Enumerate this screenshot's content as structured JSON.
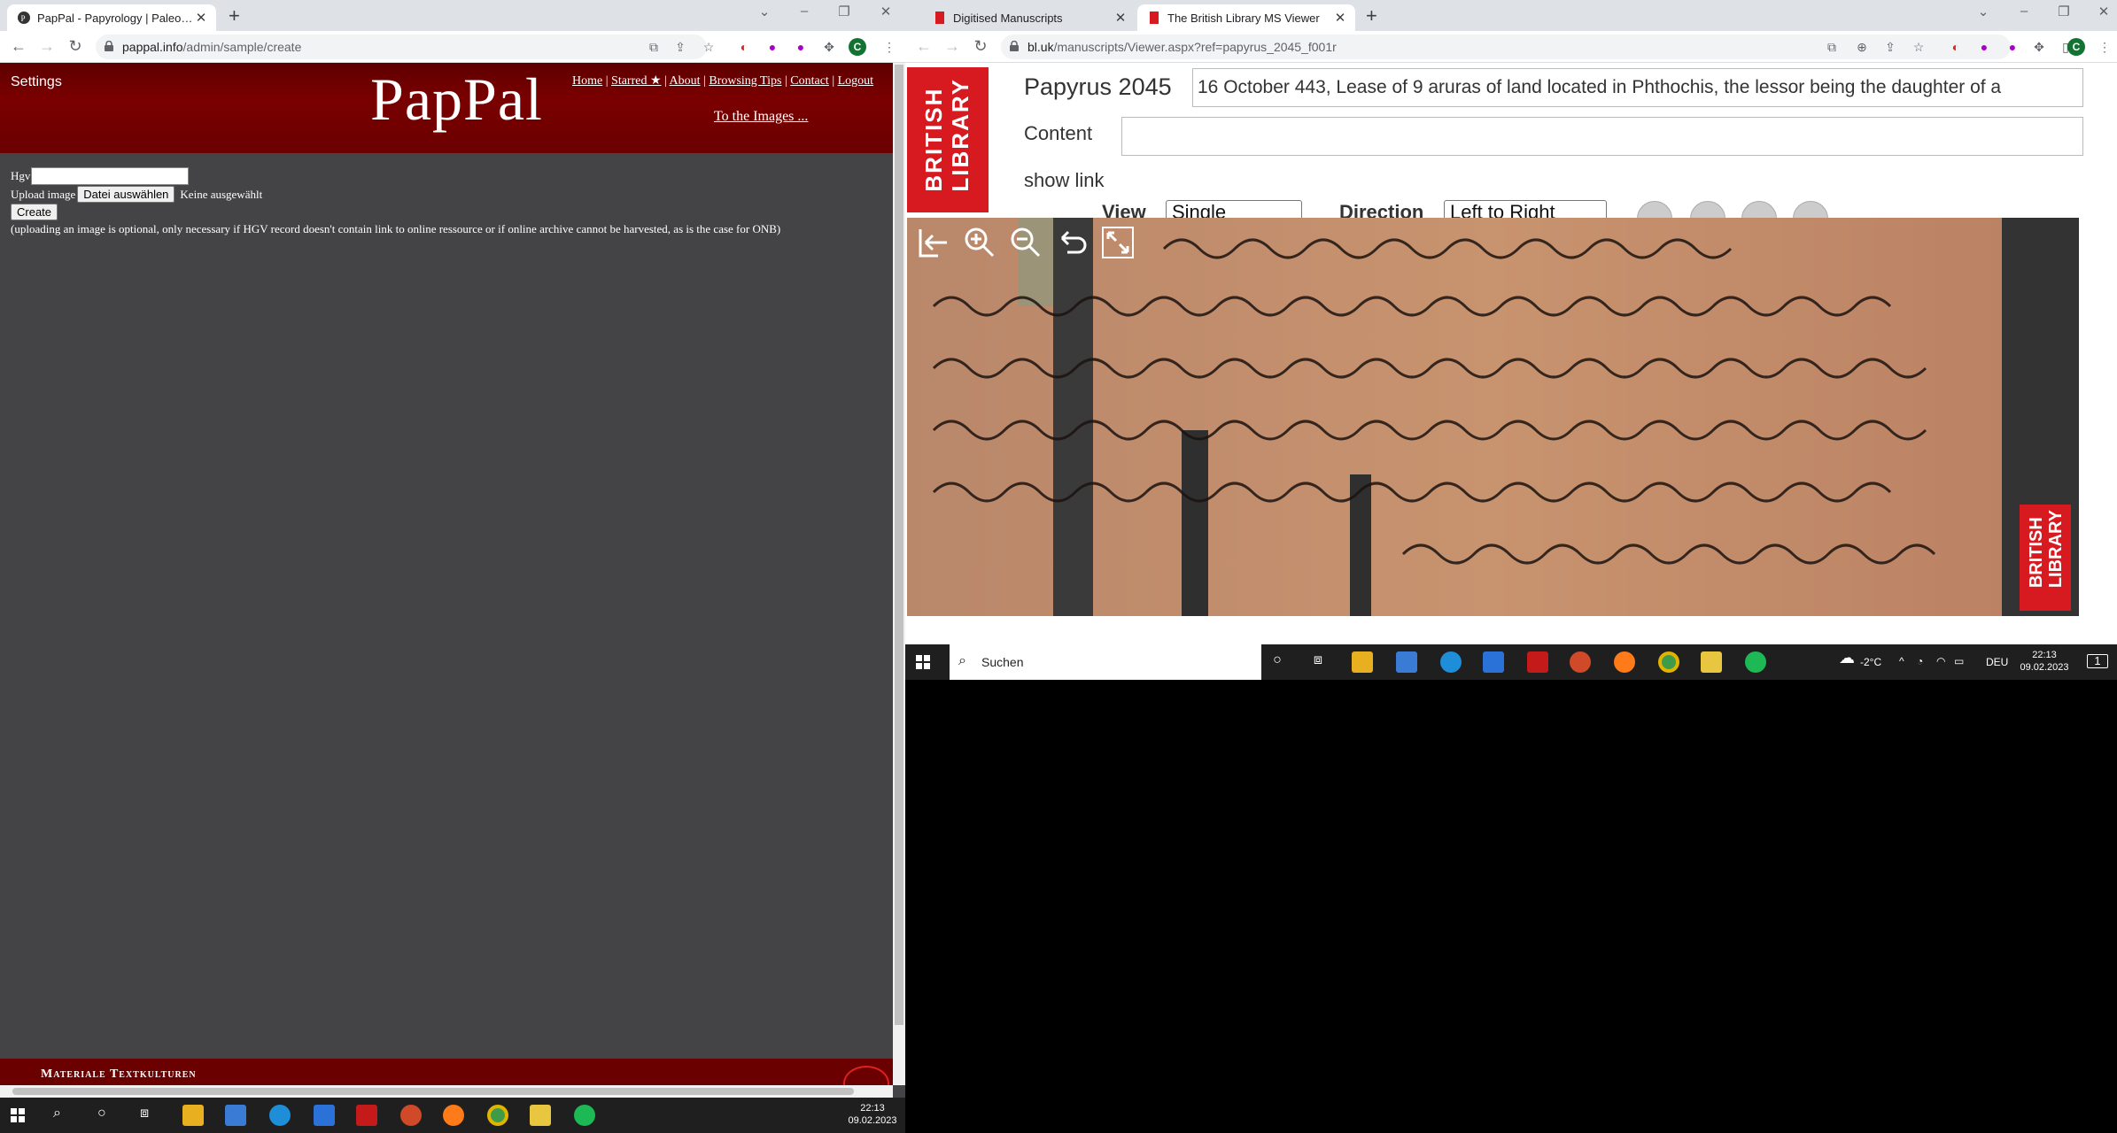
{
  "left_window": {
    "tabs": [
      {
        "title": "PapPal - Papyrology | Paleography"
      }
    ],
    "url": {
      "host": "pappal.info",
      "path": "/admin/sample/create"
    },
    "profile_initial": "C"
  },
  "pappal": {
    "settings_label": "Settings",
    "brand": "PapPal",
    "nav": [
      {
        "label": "Home"
      },
      {
        "label": "Starred ★"
      },
      {
        "label": "About"
      },
      {
        "label": "Browsing Tips"
      },
      {
        "label": "Contact"
      },
      {
        "label": "Logout"
      }
    ],
    "images_link": "To the Images ...",
    "form": {
      "hgv_label": "Hgv",
      "hgv_value": "",
      "upload_label": "Upload image",
      "file_button": "Datei auswählen",
      "file_status": "Keine ausgewählt",
      "create_button": "Create",
      "note": "(uploading an image is optional, only necessary if HGV record doesn't contain link to online ressource or if online archive cannot be harvested, as is the case for ONB)"
    },
    "footer_text": "Materiale Textkulturen"
  },
  "right_window": {
    "tabs": [
      {
        "title": "Digitised Manuscripts"
      },
      {
        "title": "The British Library MS Viewer"
      }
    ],
    "url": {
      "host": "bl.uk",
      "path": "/manuscripts/Viewer.aspx?ref=papyrus_2045_f001r"
    },
    "profile_initial": "C"
  },
  "bl_viewer": {
    "logo_text": "BRITISH\nLIBRARY",
    "title": "Papyrus 2045",
    "description": "16 October 443, Lease of 9 aruras of land located in Phthochis, the lessor being the daughter of a",
    "content_label": "Content",
    "content_value": "",
    "show_link": "show link",
    "view_label": "View",
    "view_value": "Single",
    "direction_label": "Direction",
    "direction_value": "Left to Right",
    "watermark": "BRITISH\nLIBRARY"
  },
  "taskbar_left": {
    "time": "22:13",
    "date": "09.02.2023"
  },
  "taskbar_right": {
    "search_placeholder": "Suchen",
    "weather": "-2°C",
    "lang": "DEU",
    "time": "22:13",
    "date": "09.02.2023",
    "notification_count": "1"
  }
}
